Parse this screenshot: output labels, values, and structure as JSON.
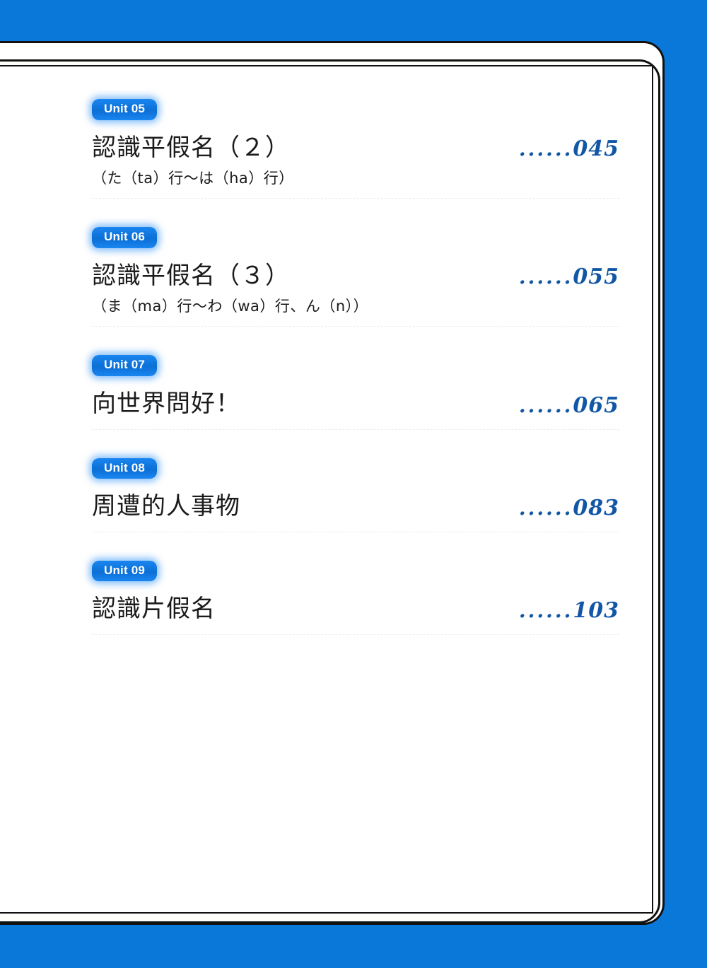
{
  "theme": {
    "background_color": "#0a78d8",
    "page_color": "#ffffff",
    "badge_color": "#0b6fd6",
    "page_number_color": "#1257a5",
    "frame_color": "#111111",
    "rule_color": "#ececec"
  },
  "toc": {
    "entries": [
      {
        "badge": "Unit 05",
        "title": "認識平假名（２）",
        "subtitle": "（た（ta）行～は（ha）行）",
        "dots": "......",
        "page": "045"
      },
      {
        "badge": "Unit 06",
        "title": "認識平假名（３）",
        "subtitle": "（ま（ma）行～わ（wa）行、ん（n））",
        "dots": "......",
        "page": "055"
      },
      {
        "badge": "Unit 07",
        "title": "向世界問好！",
        "subtitle": "",
        "dots": "......",
        "page": "065"
      },
      {
        "badge": "Unit 08",
        "title": "周遭的人事物",
        "subtitle": "",
        "dots": "......",
        "page": "083"
      },
      {
        "badge": "Unit 09",
        "title": "認識片假名",
        "subtitle": "",
        "dots": "......",
        "page": "103"
      }
    ]
  }
}
